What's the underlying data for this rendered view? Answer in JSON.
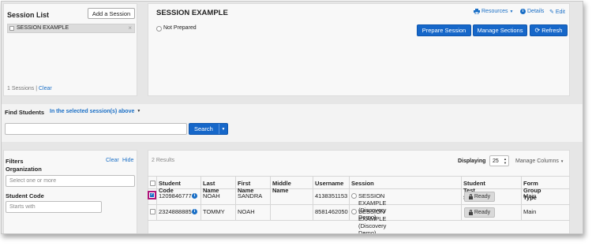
{
  "session_list": {
    "title": "Session List",
    "add_button": "Add a Session",
    "selected_session": "SESSION EXAMPLE",
    "remove_glyph": "×",
    "count": "1 Sessions",
    "separator": "|",
    "clear": "Clear"
  },
  "session_detail": {
    "title": "SESSION EXAMPLE",
    "resources": "Resources",
    "details": "Details",
    "edit": "Edit",
    "status": "Not Prepared",
    "prepare": "Prepare Session",
    "manage": "Manage Sections",
    "refresh": "Refresh"
  },
  "find_students": {
    "label": "Find Students",
    "scope": "In the selected session(s) above",
    "search_value": "",
    "search_button": "Search"
  },
  "filters": {
    "title": "Filters",
    "clear": "Clear",
    "hide": "Hide",
    "organization_label": "Organization",
    "organization_placeholder": "Select one or more",
    "student_code_label": "Student Code",
    "student_code_placeholder": "Starts with"
  },
  "results": {
    "count": "2 Results",
    "displaying_label": "Displaying",
    "page_size": "25",
    "manage_columns": "Manage Columns",
    "columns": [
      "Student Code",
      "Last Name",
      "First Name",
      "Middle Name",
      "Username",
      "Session",
      "Student Test Status",
      "Form Group Type"
    ],
    "rows": [
      {
        "student_code": "1209846777",
        "last_name": "NOAH",
        "first_name": "SANDRA",
        "middle_name": "",
        "username": "4138351153",
        "session": "SESSION EXAMPLE (Discovery Demo)",
        "status": "Ready",
        "form_group": "Main",
        "checked": true
      },
      {
        "student_code": "2324888885",
        "last_name": "TOMMY",
        "first_name": "NOAH",
        "middle_name": "",
        "username": "8581462050",
        "session": "SESSION EXAMPLE (Discovery Demo)",
        "status": "Ready",
        "form_group": "Main",
        "checked": false
      }
    ]
  },
  "colors": {
    "primary": "#1667c9",
    "link": "#1a6fc6",
    "highlight": "#b0147a"
  }
}
